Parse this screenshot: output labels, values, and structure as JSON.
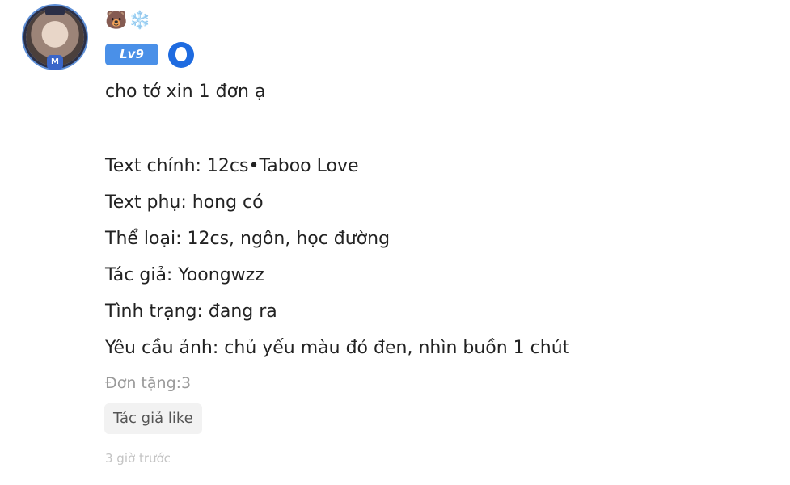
{
  "user": {
    "name_emojis": "🐻❄️",
    "level": "Lv9",
    "avatar_badge": "M"
  },
  "comment": {
    "request_line": "cho tớ xin 1 đơn ạ",
    "lines": [
      "Text chính: 12cs•Taboo Love",
      "Text phụ: hong có",
      "Thể loại: 12cs, ngôn, học đường",
      "Tác giả: Yoongwzz",
      "Tình trạng: đang ra",
      "Yêu cầu ảnh: chủ yếu màu đỏ đen, nhìn buồn 1 chút"
    ],
    "gift_count": "Đơn tặng:3",
    "author_like": "Tác giả like",
    "timestamp": "3 giờ trước"
  },
  "colors": {
    "level_badge": "#4a90e8",
    "rank_icon": "#1e6be0",
    "muted_text": "#9a9a9a"
  }
}
